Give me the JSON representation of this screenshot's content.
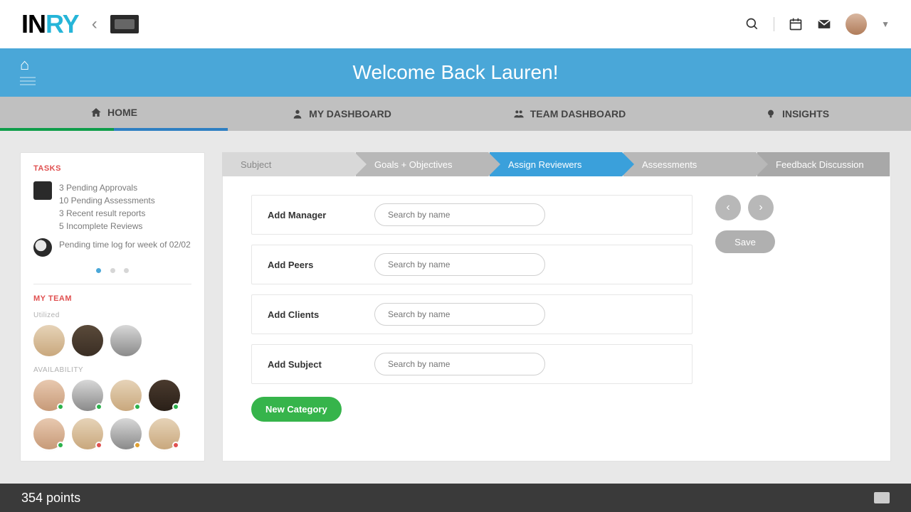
{
  "brand": {
    "part1": "IN",
    "part2": "RY"
  },
  "header": {
    "welcome": "Welcome Back Lauren!"
  },
  "nav": {
    "home": "HOME",
    "my_dashboard": "MY DASHBOARD",
    "team_dashboard": "TEAM DASHBOARD",
    "insights": "INSIGHTS"
  },
  "sidebar": {
    "tasks_title": "TASKS",
    "task_list": {
      "approvals": "3 Pending Approvals",
      "assessments": "10 Pending Assessments",
      "reports": "3 Recent result reports",
      "reviews": "5 Incomplete Reviews"
    },
    "time_log": "Pending time log for week of 02/02",
    "my_team_title": "MY TEAM",
    "utilized": "Utilized",
    "availability": "AVAILABILITY"
  },
  "stepper": {
    "s1": "Subject",
    "s2": "Goals + Objectives",
    "s3": "Assign Reviewers",
    "s4": "Assessments",
    "s5": "Feedback Discussion"
  },
  "form": {
    "add_manager": "Add Manager",
    "add_peers": "Add Peers",
    "add_clients": "Add Clients",
    "add_subject": "Add Subject",
    "placeholder": "Search by name",
    "new_category": "New Category",
    "save": "Save"
  },
  "footer": {
    "points": "354 points"
  }
}
